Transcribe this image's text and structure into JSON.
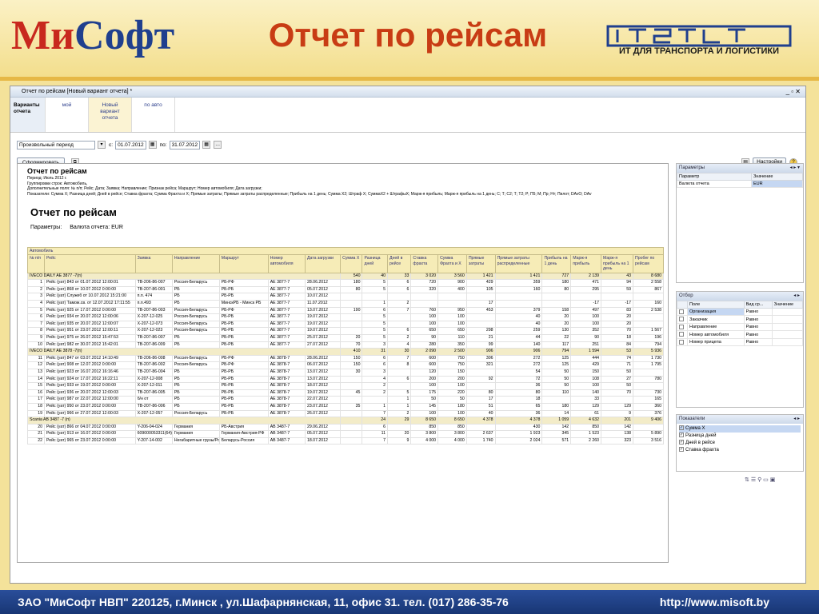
{
  "slide": {
    "logo_part1": "Ми",
    "logo_part2": "Софт",
    "title": "Отчет по рейсам",
    "brand_sub": "ИТ ДЛЯ ТРАНСПОРТА И ЛОГИСТИКИ",
    "footer_address": "ЗАО \"МиСофт НВП\"  220125, г.Минск , ул.Шафарнянская, 11, офис 31. тел. (017) 286-35-76",
    "footer_url": "http://www.misoft.by"
  },
  "window": {
    "title": "Отчет по рейсам [Новый вариант отчета] *",
    "controls": "_ ▫ ✕"
  },
  "variants": {
    "label": "Варианты отчета",
    "items": [
      "мой",
      "Новый вариант отчета",
      "по авто"
    ]
  },
  "period": {
    "select_value": "Произвольный период",
    "from_label": "с:",
    "from_value": "01.07.2012",
    "to_label": "по:",
    "to_value": "31.07.2012"
  },
  "toolbar": {
    "generate_label": "Сформировать",
    "settings_label": "Настройки"
  },
  "report": {
    "head_title": "Отчет по рейсам",
    "period_line": "Период: Июль 2012 г.",
    "grouping_line": "Группировки строк: Автомобиль,",
    "extra_fields_line": "Дополнительные поля: № п/п; Рейс; Дата; Заявка; Направление; Признак рейса; Маршрут; Номер автомобиля; Дата загрузки;",
    "indicators_line": "Показатели: Сумма Х; Разница дней; Дней в рейсе; Ставка фрахта; Сумма Фрахта и Х; Прямые затраты; Прямые затраты распределенные; Прибыль на 1 день; Сумма Х2; Штраф Х; СуммаХ2 + ШтрафыХ; Марж-я прибыль; Марж-я прибыль на 1 день; С; Т; С2; Т; Т2; Р; П5; М; Пр; Нт; Пилот; DAvO; DAv",
    "big_title": "Отчет по рейсам",
    "params_label": "Параметры:",
    "params_value": "Валюта отчета: EUR"
  },
  "table": {
    "group_header": "Автомобиль",
    "columns": [
      "№ п/п",
      "Рейс",
      "Заявка",
      "Направление",
      "Маршрут",
      "Номер автомобиля",
      "Дата загрузки",
      "Сумма Х",
      "Разница дней",
      "Дней в рейсе",
      "Ставка фрахта",
      "Сумма Фрахта и Х",
      "Прямые затраты",
      "Прямые затраты распределенные",
      "Прибыль на 1 день",
      "Марж-я прибыль",
      "Марж-я прибыль на 1 день",
      "Пробег по рейсам"
    ],
    "groups": [
      {
        "name": "IVECO DAILY AE 3877 -7(п)",
        "totals": [
          "540",
          "40",
          "33",
          "3 020",
          "3 560",
          "1 421",
          "1 421",
          "727",
          "2 139",
          "43",
          "8 680"
        ]
      },
      {
        "name": "IVECO DAILY AE 3878 -7(п)",
        "totals": [
          "410",
          "31",
          "30",
          "2 090",
          "2 500",
          "906",
          "906",
          "794",
          "1 594",
          "53",
          "5 936"
        ]
      },
      {
        "name": "Scania  AB 3487 -7 (п)",
        "totals": [
          "",
          "24",
          "29",
          "8 650",
          "8 650",
          "4 378",
          "4 378",
          "1 059",
          "4 632",
          "201",
          "9 406"
        ]
      }
    ],
    "rows": [
      [
        "1",
        "Рейс (уат) 843 от 01.07.2012 12:00:01",
        "ТВ-206-86-007",
        "Россия-Беларусь",
        "РБ-РФ",
        "АЕ 3877-7",
        "28.06.2012",
        "180",
        "5",
        "6",
        "720",
        "900",
        "429",
        "359",
        "180",
        "471",
        "94",
        "2 558"
      ],
      [
        "2",
        "Рейс (уат) 868 от 10.07.2012 0:00:00",
        "ТВ-207-86-001",
        "РБ",
        "РБ-РБ",
        "АЕ 3877-7",
        "05.07.2012",
        "80",
        "5",
        "6",
        "320",
        "400",
        "105",
        "160",
        "80",
        "295",
        "59",
        "867"
      ],
      [
        "3",
        "Рейс (уат) Служеб от 10.07.2012 15:21:00",
        "п.п. 474",
        "РБ",
        "РБ-РБ",
        "АЕ 3877-7",
        "10.07.2012",
        "",
        "",
        "",
        "",
        "",
        "",
        "",
        "",
        "",
        "",
        ""
      ],
      [
        "4",
        "Рейс (уат) Тамож.св. от 12.07.2012 17:11:55",
        "п.п.493",
        "РБ",
        "МинскРБ - Минск РБ",
        "АЕ 3877-7",
        "11.07.2012",
        "",
        "1",
        "2",
        "",
        "",
        "17",
        "",
        "",
        "-17",
        "-17",
        "160"
      ],
      [
        "5",
        "Рейс (уат) 925 от 17.07.2012 0:00:00",
        "ТВ-207-86-003",
        "Россия-Беларусь",
        "РБ-РФ",
        "АЕ 3877-7",
        "13.07.2012",
        "190",
        "6",
        "7",
        "760",
        "950",
        "453",
        "379",
        "158",
        "497",
        "83",
        "2 538"
      ],
      [
        "6",
        "Рейс (уат) 934 от 20.07.2012 12:00:06",
        "Х-207-12-025",
        "Россия-Беларусь",
        "РБ-РБ",
        "АЕ 3877-7",
        "19.07.2012",
        "",
        "5",
        "",
        "100",
        "100",
        "",
        "40",
        "20",
        "100",
        "20",
        ""
      ],
      [
        "7",
        "Рейс (уат) 935 от 20.07.2012 12:00:07",
        "Х-207-12-073",
        "Россия-Беларусь",
        "РБ-РБ",
        "АЕ 3877-7",
        "19.07.2012",
        "",
        "5",
        "",
        "100",
        "100",
        "",
        "40",
        "20",
        "100",
        "20",
        ""
      ],
      [
        "8",
        "Рейс (уат) 951 от 23.07.2012 12:00:11",
        "Х-207-12-023",
        "Россия-Беларусь",
        "РБ-РБ",
        "АЕ 3877-7",
        "19.07.2012",
        "",
        "5",
        "6",
        "650",
        "650",
        "298",
        "259",
        "130",
        "352",
        "70",
        "1 567"
      ],
      [
        "9",
        "Рейс (уат) 975 от 26.07.2012 15:47:53",
        "ТВ-207-86-007",
        "РБ",
        "РБ-РБ",
        "АЕ 3877-7",
        "25.07.2012",
        "20",
        "5",
        "2",
        "90",
        "110",
        "21",
        "44",
        "22",
        "90",
        "18",
        "196"
      ],
      [
        "10",
        "Рейс (уат) 982 от 30.07.2012 15:42:01",
        "ТВ-207-86-009",
        "РБ",
        "РБ-РБ",
        "АЕ 3877-7",
        "27.07.2012",
        "70",
        "3",
        "4",
        "280",
        "350",
        "99",
        "140",
        "117",
        "251",
        "84",
        "794"
      ],
      [
        "11",
        "Рейс (уат) 847 от 03.07.2012 14:10:49",
        "ТВ-206-86-008",
        "Россия-Беларусь",
        "РБ-РФ",
        "АЕ 3878-7",
        "28.06.2012",
        "150",
        "6",
        "7",
        "600",
        "750",
        "306",
        "272",
        "125",
        "444",
        "74",
        "1 730"
      ],
      [
        "12",
        "Рейс (уат) 908 от 12.07.2012 0:00:00",
        "ТВ-207-86-002",
        "Россия-Беларусь",
        "РБ-РФ",
        "АЕ 3878-7",
        "06.07.2012",
        "150",
        "6",
        "8",
        "600",
        "750",
        "321",
        "272",
        "125",
        "429",
        "71",
        "1 795"
      ],
      [
        "13",
        "Рейс (уат) 923 от 16.07.2012 16:16:46",
        "ТВ-207-86-004",
        "РБ",
        "РБ-РБ",
        "АЕ 3878-7",
        "13.07.2012",
        "30",
        "3",
        "",
        "120",
        "150",
        "",
        "54",
        "50",
        "150",
        "50",
        ""
      ],
      [
        "14",
        "Рейс (уат) 924 от 17.07.2012 16:22:11",
        "Х-207-12-008",
        "РБ",
        "РБ-РБ",
        "АЕ 3878-7",
        "13.07.2012",
        "",
        "4",
        "6",
        "200",
        "200",
        "92",
        "72",
        "50",
        "108",
        "27",
        "780"
      ],
      [
        "15",
        "Рейс (уат) 933 от 19.07.2012 0:00:00",
        "Х-207-12-011",
        "РБ",
        "РБ-РБ",
        "АЕ 3878-7",
        "18.07.2012",
        "",
        "2",
        "",
        "100",
        "100",
        "",
        "36",
        "50",
        "100",
        "50",
        ""
      ],
      [
        "16",
        "Рейс (уат) 936 от 20.07.2012 12:00:03",
        "ТВ-207-86-005",
        "РБ",
        "РБ-РБ",
        "АЕ 3878-7",
        "19.07.2012",
        "45",
        "2",
        "5",
        "175",
        "220",
        "80",
        "80",
        "110",
        "140",
        "70",
        "730"
      ],
      [
        "17",
        "Рейс (уат) 987 от 22.07.2012 12:00:00",
        "б/н от",
        "РБ",
        "РБ-РБ",
        "АЕ 3878-7",
        "22.07.2012",
        "",
        "",
        "1",
        "50",
        "50",
        "17",
        "18",
        "",
        "33",
        "",
        "165"
      ],
      [
        "18",
        "Рейс (уат) 950 от 23.07.2012 0:00:00",
        "ТВ-207-86-006",
        "РБ",
        "РБ-РБ",
        "АЕ 3878-7",
        "23.07.2012",
        "35",
        "1",
        "1",
        "145",
        "180",
        "51",
        "65",
        "180",
        "129",
        "129",
        "360"
      ],
      [
        "19",
        "Рейс (уат) 966 от 27.07.2012 12:00:03",
        "Х-207-12-057",
        "Россия-Беларусь",
        "РБ-РБ",
        "АЕ 3878-7",
        "26.07.2012",
        "",
        "7",
        "2",
        "100",
        "100",
        "40",
        "36",
        "14",
        "61",
        "9",
        "376"
      ],
      [
        "20",
        "Рейс (уат) 866 от 04.07.2012 0:00:00",
        "Y-206-04-024",
        "Германия",
        "РБ-Австрия",
        "АВ 3487-7",
        "29.06.2012",
        "",
        "6",
        "",
        "850",
        "850",
        "",
        "430",
        "142",
        "850",
        "142",
        ""
      ],
      [
        "21",
        "Рейс (уат) 913 от 16.07.2012 0:00:00",
        "609000053311(64)",
        "Германия",
        "Германия-Австрия-РФ",
        "АВ 3487-7",
        "05.07.2012",
        "",
        "11",
        "20",
        "3 800",
        "3 800",
        "2 637",
        "1 923",
        "345",
        "1 523",
        "138",
        "5 890"
      ],
      [
        "22",
        "Рейс (уат) 965 от 23.07.2012 0:00:00",
        "Y-207-14-002",
        "Негабаритные грузы/Россия",
        "Беларусь-Россия",
        "АВ 3487-7",
        "18.07.2012",
        "",
        "7",
        "9",
        "4 000",
        "4 000",
        "1 740",
        "2 024",
        "571",
        "2 260",
        "323",
        "3 516"
      ]
    ]
  },
  "side_params": {
    "title": "Параметры",
    "col1": "Параметр",
    "col2": "Значение",
    "row_name": "Валюта отчета",
    "row_value": "EUR"
  },
  "side_filter": {
    "title": "Отбор",
    "col1": "Поле",
    "col2": "Вид ср...",
    "col3": "Значение",
    "rows": [
      {
        "name": "Организация",
        "op": "Равно"
      },
      {
        "name": "Заказчик",
        "op": "Равно"
      },
      {
        "name": "Направление",
        "op": "Равно"
      },
      {
        "name": "Номер автомобиля",
        "op": "Равно"
      },
      {
        "name": "Номер прицепа",
        "op": "Равно"
      }
    ]
  },
  "side_indicators": {
    "title": "Показатели",
    "items": [
      "Сумма Х",
      "Разница дней",
      "Дней в рейсе",
      "Ставка фрахта"
    ]
  }
}
